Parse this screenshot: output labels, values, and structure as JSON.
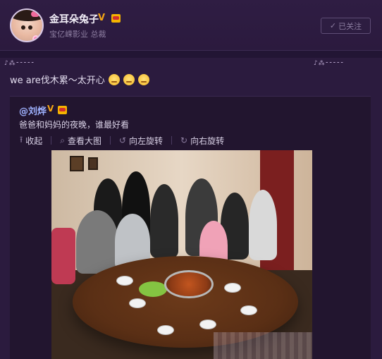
{
  "header": {
    "username": "金耳朵兔子",
    "verified": "V",
    "subtitle": "宝亿嵘影业 总裁",
    "follow_button": "已关注",
    "follow_check": "✓"
  },
  "post": {
    "text": "we are伐木累～太开心",
    "emojis": [
      "smile",
      "smile",
      "smile"
    ]
  },
  "repost": {
    "user": "@刘烨",
    "verified": "V",
    "text": "爸爸和妈妈的夜晚，谁最好看"
  },
  "actions": [
    {
      "label": "收起",
      "icon": "arrow-up-icon",
      "glyph": "⭱"
    },
    {
      "label": "查看大图",
      "icon": "search-icon",
      "glyph": "⌕"
    },
    {
      "label": "向左旋转",
      "icon": "rotate-left-icon",
      "glyph": "↺"
    },
    {
      "label": "向右旋转",
      "icon": "rotate-right-icon",
      "glyph": "↻"
    }
  ],
  "colors": {
    "background": "#2a1a3c",
    "accent_gold": "#f2a516",
    "link_blue": "#9fb2ff"
  }
}
